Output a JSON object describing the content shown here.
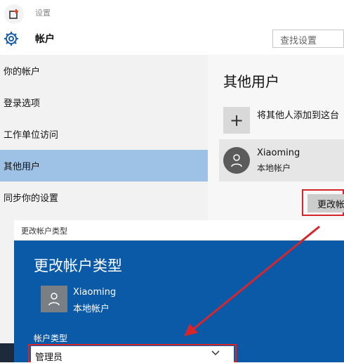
{
  "window": {
    "title": "设置"
  },
  "header": {
    "title": "帐户",
    "search_placeholder": "查找设置"
  },
  "sidebar": {
    "items": [
      {
        "label": "你的帐户",
        "active": false
      },
      {
        "label": "登录选项",
        "active": false
      },
      {
        "label": "工作单位访问",
        "active": false
      },
      {
        "label": "其他用户",
        "active": true
      },
      {
        "label": "同步你的设置",
        "active": false
      }
    ]
  },
  "main": {
    "title": "其他用户",
    "add_label": "将其他人添加到这台",
    "user": {
      "name": "Xiaoming",
      "type": "本地帐户"
    },
    "change_button": "更改帐"
  },
  "dialog": {
    "window_title": "更改帐户类型",
    "heading": "更改帐户类型",
    "user": {
      "name": "Xiaoming",
      "type": "本地帐户"
    },
    "field_label": "帐户类型",
    "selected_value": "管理员"
  },
  "colors": {
    "accent": "#0b5aa8",
    "highlight": "#9dc2e6",
    "annotation": "#d6262c"
  },
  "icons": [
    "back-icon",
    "gear-icon",
    "plus-icon",
    "user-avatar-icon",
    "chevron-down-icon"
  ]
}
